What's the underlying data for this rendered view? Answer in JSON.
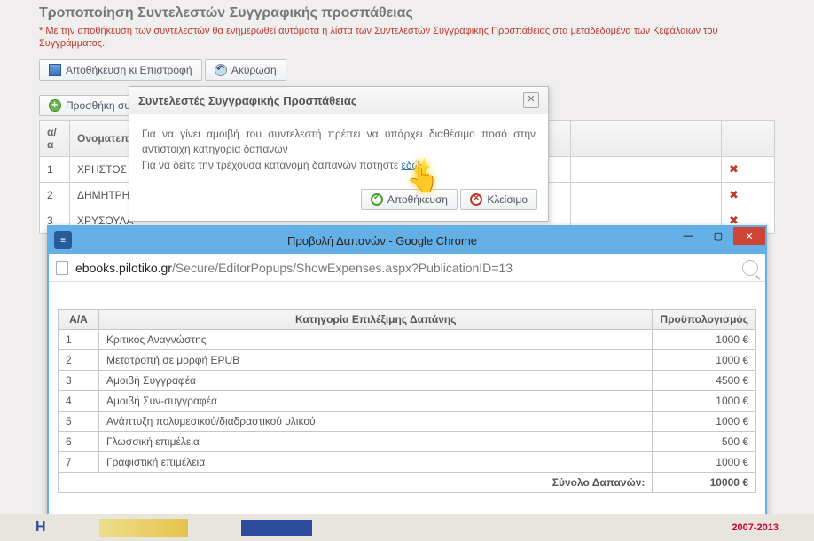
{
  "page": {
    "title": "Τροποποίηση Συντελεστών Συγγραφικής προσπάθειας",
    "warning": "* Με την αποθήκευση των συντελεστών θα ενημερωθεί αυτόματα η λίστα των Συντελεστών Συγγραφικής Προσπάθειας στα μεταδεδομένα των Κεφάλαιων του Συγγράμματος."
  },
  "toolbar": {
    "save_label": "Αποθήκευση κι Επιστροφή",
    "cancel_label": "Ακύρωση"
  },
  "add_button_label": "Προσθήκη συντε",
  "table": {
    "headers": {
      "aa": "α/α",
      "name": "Ονοματεπώ"
    },
    "rows": [
      {
        "aa": "1",
        "name": "ΧΡΗΣΤΟΣ Β"
      },
      {
        "aa": "2",
        "name": "ΔΗΜΗΤΡΗΣ"
      },
      {
        "aa": "3",
        "name": "ΧΡΥΣΟΥΛΑ"
      }
    ]
  },
  "modal": {
    "title": "Συντελεστές Συγγραφικής Προσπάθειας",
    "body_line1": "Για να γίνει αμοιβή του συντελεστή πρέπει να υπάρχει διαθέσιμο ποσό στην αντίστοιχη κατηγορία δαπανών",
    "body_line2_pre": "Για να δείτε την τρέχουσα κατανομή δαπανών πατήστε ",
    "body_line2_link": "εδώ",
    "save_label": "Αποθήκευση",
    "close_label": "Κλείσιμο"
  },
  "browser": {
    "window_title": "Προβολή Δαπανών - Google Chrome",
    "url_host": "ebooks.pilotiko.gr",
    "url_path": "/Secure/EditorPopups/ShowExpenses.aspx?PublicationID=13"
  },
  "expenses": {
    "headers": {
      "aa": "Α/Α",
      "category": "Κατηγορία Επιλέξιμης Δαπάνης",
      "budget": "Προϋπολογισμός"
    },
    "rows": [
      {
        "aa": "1",
        "category": "Κριτικός Αναγνώστης",
        "budget": "1000 €"
      },
      {
        "aa": "2",
        "category": "Μετατροπή σε μορφή EPUB",
        "budget": "1000 €"
      },
      {
        "aa": "3",
        "category": "Αμοιβή Συγγραφέα",
        "budget": "4500 €"
      },
      {
        "aa": "4",
        "category": "Αμοιβή Συν-συγγραφέα",
        "budget": "1000 €"
      },
      {
        "aa": "5",
        "category": "Ανάπτυξη πολυμεσικού/διαδραστικού υλικού",
        "budget": "1000 €"
      },
      {
        "aa": "6",
        "category": "Γλωσσική επιμέλεια",
        "budget": "500 €"
      },
      {
        "aa": "7",
        "category": "Γραφιστική επιμέλεια",
        "budget": "1000 €"
      }
    ],
    "total_label": "Σύνολο Δαπανών:",
    "total_value": "10000 €"
  },
  "footer": {
    "brand1": "H",
    "nsrf": "2007-2013"
  }
}
